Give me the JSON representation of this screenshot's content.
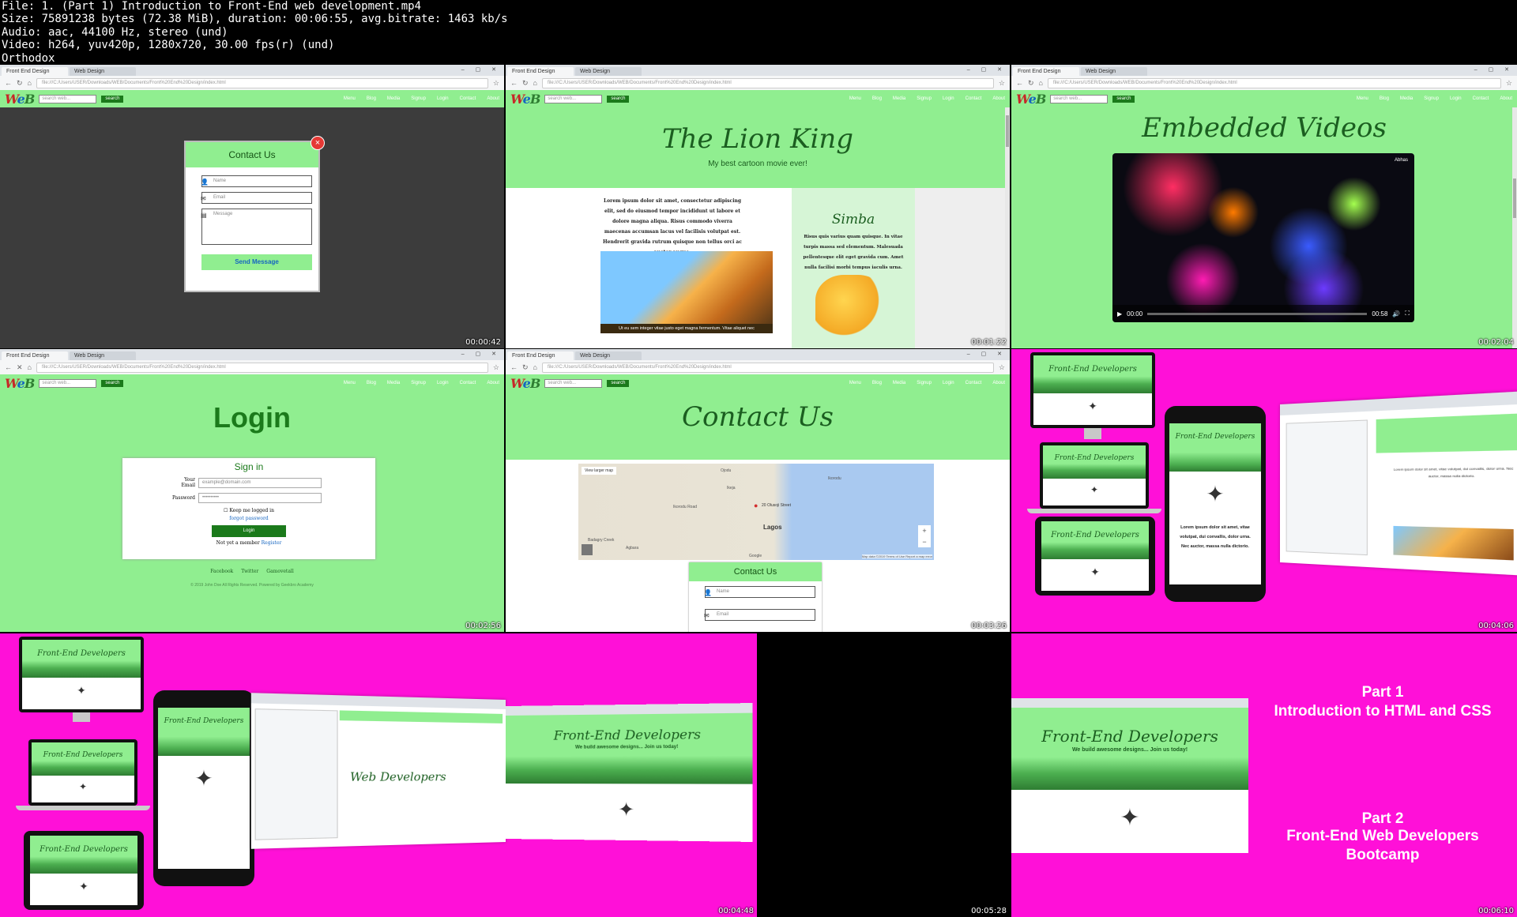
{
  "header": {
    "file": "File: 1. (Part 1) Introduction to Front-End web development.mp4",
    "size": "Size: 75891238 bytes (72.38 MiB), duration: 00:06:55, avg.bitrate: 1463 kb/s",
    "audio": "Audio: aac, 44100 Hz, stereo (und)",
    "video": "Video: h264, yuv420p, 1280x720, 30.00 fps(r) (und)",
    "extra": "Orthodox"
  },
  "browser": {
    "tab1": "Front End Design",
    "tab2": "Web Design",
    "address": "file:///C:/Users/USER/Downloads/WEB/Documents/Front%20End%20Design/index.html"
  },
  "site": {
    "logo_w": "W",
    "logo_e": "e",
    "logo_b": "B",
    "search_placeholder": "search web...",
    "search_button": "search",
    "menu": [
      "Menu",
      "Blog",
      "Media",
      "Signup",
      "Login",
      "Contact",
      "About"
    ]
  },
  "tiles": {
    "t1": {
      "timestamp": "00:00:42",
      "modal_title": "Contact Us",
      "name_placeholder": "Name",
      "email_placeholder": "Email",
      "message_placeholder": "Message",
      "send": "Send Message",
      "close": "×"
    },
    "t2": {
      "timestamp": "00:01:22",
      "title": "The Lion King",
      "subtitle": "My best cartoon movie ever!",
      "body": "Lorem ipsum dolor sit amet, consectetur adipiscing elit, sed do eiusmod tempor incididunt ut labore et dolore magna aliqua. Risus commodo viverra maecenas accumsan lacus vel facilisis volutpat est. Hendrerit gravida rutrum quisque non tellus orci ac auctor augue.",
      "caption": "Ut eu sem integer vitae justo eget magna fermentum. Vitae aliquet nec",
      "side_title": "Simba",
      "side_text": "Risus quis varius quam quisque. In vitae turpis massa sed elementum. Malesuada pellentesque elit eget gravida cum. Amet nulla facilisi morbi tempus iaculis urna."
    },
    "t3": {
      "timestamp": "00:02:04",
      "title": "Embedded Videos",
      "time_start": "00:00",
      "time_end": "00:58",
      "badge": "Abhas"
    },
    "t4": {
      "timestamp": "00:02:56",
      "title": "Login",
      "card_title": "Sign in",
      "email_label": "Your Email",
      "email_placeholder": "example@domain.com",
      "password_label": "Password",
      "password_value": "••••••••••",
      "remember": "Keep me logged in",
      "forgot": "forgot password",
      "login_btn": "Login",
      "not_member": "Not yet a member",
      "register": "Register",
      "social": [
        "Facebook",
        "Twitter",
        "Gamovetall"
      ],
      "footer": "© 2019 John Doe All Rights Reserved. Powered by Geekbro Academy"
    },
    "t5": {
      "timestamp": "00:03:26",
      "title": "Contact Us",
      "map_btn": "View larger map",
      "map_pin": "20 Olusoji Street",
      "map_city": "Lagos",
      "map_places": [
        "Ojodu",
        "Ikorodu",
        "Ikeja",
        "Badagry Creek",
        "Agbara",
        "Ikorodu Road"
      ],
      "zoom_in": "+",
      "zoom_out": "−",
      "map_footer": "Map data ©2019  Terms of Use  Report a map error",
      "google": "Google",
      "card_title": "Contact Us",
      "name_placeholder": "Name",
      "email_placeholder": "Email"
    },
    "t6": {
      "timestamp": "00:04:06",
      "device_title": "Front-End Developers",
      "body_text": "Lorem ipsum dolor sit amet, vitae volutpat, dui convallis, dolor urna. Nec auctor, massa nulla dictorio."
    },
    "t7": {
      "timestamp": "00:04:48",
      "device_title": "Front-End Developers",
      "banner_title": "Front-End Developers",
      "banner_sub": "We build awesome designs... Join us today!",
      "web_dev_title": "Web Developers"
    },
    "t8": {
      "timestamp": "00:05:28",
      "banner_title": "Front-End Developers",
      "banner_sub": "We build awesome designs... Join us today!"
    },
    "t9": {
      "timestamp": "00:06:10",
      "part1_label": "Part 1",
      "part1_title": "Introduction to HTML and CSS",
      "part2_label": "Part 2",
      "part2_title": "Front-End Web Developers",
      "part2_title2": "Bootcamp"
    }
  },
  "colors": {
    "pink": "#ff10d8",
    "site_green": "#90ee90",
    "dark_green": "#1b7a1b"
  }
}
